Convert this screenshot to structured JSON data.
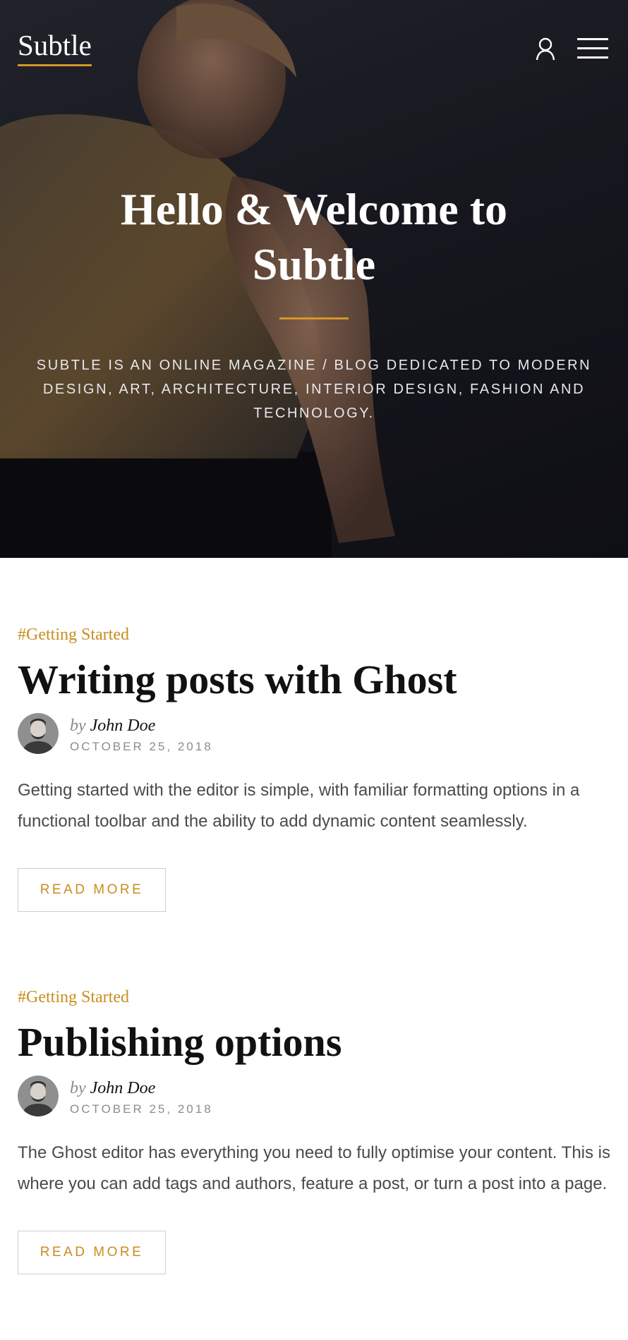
{
  "header": {
    "logo": "Subtle",
    "account_icon": "user-icon",
    "menu_icon": "hamburger-menu-icon",
    "accent_color": "#d4962b"
  },
  "hero": {
    "title": "Hello & Welcome to Subtle",
    "description": "SUBTLE IS AN ONLINE MAGAZINE / BLOG DEDICATED TO MODERN DESIGN, ART, ARCHITECTURE, INTERIOR DESIGN, FASHION AND TECHNOLOGY."
  },
  "posts": [
    {
      "tag": "#Getting Started",
      "title": "Writing posts with Ghost",
      "by": "by",
      "author": "John Doe",
      "date": "OCTOBER 25, 2018",
      "excerpt": "Getting started with the editor is simple, with familiar formatting options in a functional toolbar and the ability to add dynamic content seamlessly.",
      "read_more": "READ MORE"
    },
    {
      "tag": "#Getting Started",
      "title": "Publishing options",
      "by": "by",
      "author": "John Doe",
      "date": "OCTOBER 25, 2018",
      "excerpt": "The Ghost editor has everything you need to fully optimise your content. This is where you can add tags and authors, feature a post, or turn a post into a page.",
      "read_more": "READ MORE"
    }
  ]
}
